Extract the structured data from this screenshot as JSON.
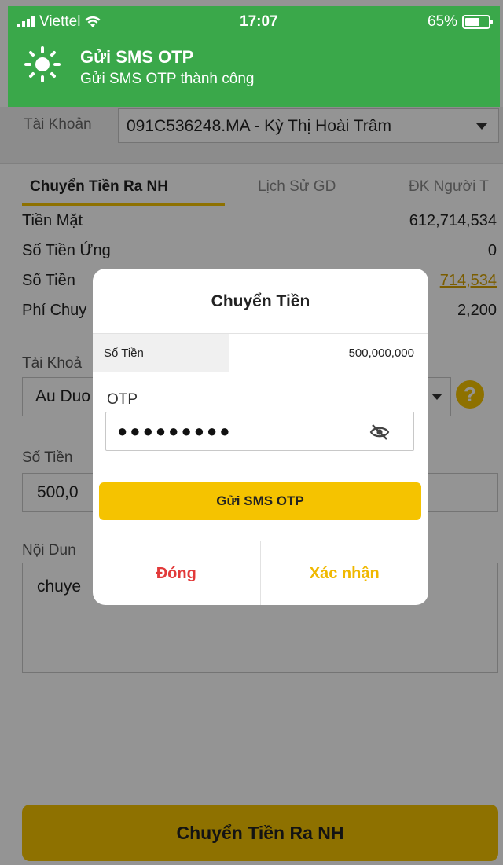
{
  "status_bar": {
    "carrier": "Viettel",
    "time": "17:07",
    "battery": "65%"
  },
  "notification": {
    "title": "Gửi SMS OTP",
    "subtitle": "Gửi SMS OTP thành công",
    "icon": "sun-icon"
  },
  "account": {
    "label": "Tài Khoản",
    "value": "091C536248.MA - Kỳ Thị Hoài Trâm"
  },
  "tabs": [
    {
      "label": "Chuyển Tiền Ra NH",
      "active": true
    },
    {
      "label": "Lịch Sử GD",
      "active": false
    },
    {
      "label": "ĐK Người T",
      "active": false
    }
  ],
  "balances": [
    {
      "label": "Tiền Mặt",
      "value": "612,714,534"
    },
    {
      "label": "Số Tiền Ứng",
      "value": "0"
    },
    {
      "label": "Số Tiền",
      "value": "714,534"
    },
    {
      "label": "Phí Chuy",
      "value": "2,200"
    }
  ],
  "form": {
    "bank_account_label": "Tài Khoả",
    "bank_account_value": "Au Duo",
    "amount_label": "Số Tiền",
    "amount_value": "500,0",
    "content_label": "Nội Dun",
    "content_value": "chuye"
  },
  "bottom_button": "Chuyển Tiền Ra NH",
  "modal": {
    "title": "Chuyển Tiền",
    "amount_label": "Số Tiền",
    "amount_value": "500,000,000",
    "otp_label": "OTP",
    "otp_value": "●●●●●●●●●",
    "send_sms_button": "Gửi SMS OTP",
    "close_button": "Đóng",
    "confirm_button": "Xác nhận"
  },
  "colors": {
    "accent": "#f5c300",
    "header_green": "#3aa84a",
    "close_red": "#e23a3a",
    "confirm_yellow": "#f0b800"
  }
}
